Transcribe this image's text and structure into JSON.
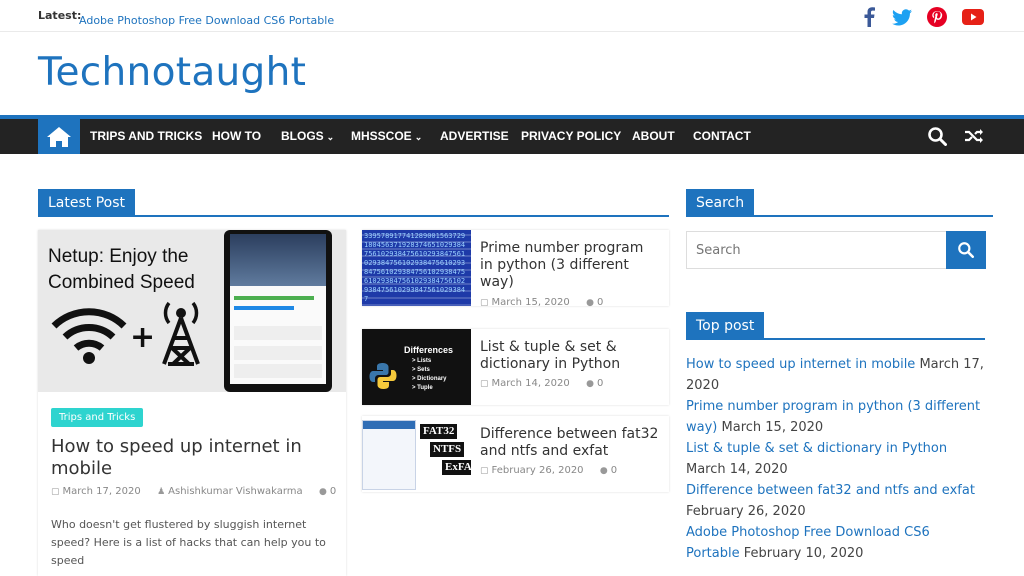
{
  "topbar": {
    "latest_label": "Latest:",
    "latest_link": "Adobe Photoshop Free Download CS6 Portable",
    "social": [
      "facebook-icon",
      "twitter-icon",
      "pinterest-icon",
      "youtube-icon"
    ]
  },
  "brand": {
    "title": "Technotaught"
  },
  "nav": {
    "items": [
      {
        "label": "TRIPS AND TRICKS",
        "dropdown": false
      },
      {
        "label": "HOW TO",
        "dropdown": false
      },
      {
        "label": "BLOGS",
        "dropdown": true
      },
      {
        "label": "MHSSCOE",
        "dropdown": true
      },
      {
        "label": "ADVERTISE",
        "dropdown": false
      },
      {
        "label": "PRIVACY POLICY",
        "dropdown": false
      },
      {
        "label": "ABOUT",
        "dropdown": false
      },
      {
        "label": "CONTACT",
        "dropdown": false
      }
    ],
    "chevron": "⌄"
  },
  "latest_post": {
    "heading": "Latest Post",
    "featured": {
      "image_text_1": "Netup: Enjoy the",
      "image_text_2": "Combined Speed",
      "category": "Trips and Tricks",
      "title": "How to speed up internet in mobile",
      "date": "March 17, 2020",
      "author": "Ashishkumar Vishwakarma",
      "comments": "0",
      "excerpt": "Who doesn't get flustered by sluggish internet speed? Here is a list of hacks that can help you to speed"
    },
    "posts": [
      {
        "title": "Prime number program in python (3 different way)",
        "date": "March 15, 2020",
        "comments": "0"
      },
      {
        "title": "List & tuple & set & dictionary in Python",
        "date": "March 14, 2020",
        "comments": "0"
      },
      {
        "title": "Difference between fat32 and ntfs and exfat",
        "date": "February 26, 2020",
        "comments": "0"
      }
    ],
    "thumb2": {
      "title": "Differences",
      "items": [
        "> Lists",
        "> Sets",
        "> Dictionary",
        "> Tuple"
      ]
    },
    "thumb3": {
      "labels": [
        "FAT32",
        "NTFS",
        "ExFAT"
      ]
    }
  },
  "sidebar": {
    "search_heading": "Search",
    "search_placeholder": "Search",
    "top_heading": "Top post",
    "top_posts": [
      {
        "title": "How to speed up internet in mobile",
        "date": "March 17, 2020"
      },
      {
        "title": "Prime number program in python (3 different way)",
        "date": "March 15, 2020"
      },
      {
        "title": "List & tuple & set & dictionary in Python",
        "date": "March 14, 2020"
      },
      {
        "title": "Difference between fat32 and ntfs and exfat",
        "date": "February 26, 2020"
      },
      {
        "title": "Adobe Photoshop Free Download CS6 Portable",
        "date": "February 10, 2020"
      }
    ]
  },
  "colors": {
    "accent": "#1e73be",
    "nav_bg": "#232323",
    "tag_bg": "#2ed4cf",
    "facebook": "#3b5998",
    "twitter": "#1da1f2",
    "pinterest": "#e60023",
    "youtube": "#e62117"
  }
}
